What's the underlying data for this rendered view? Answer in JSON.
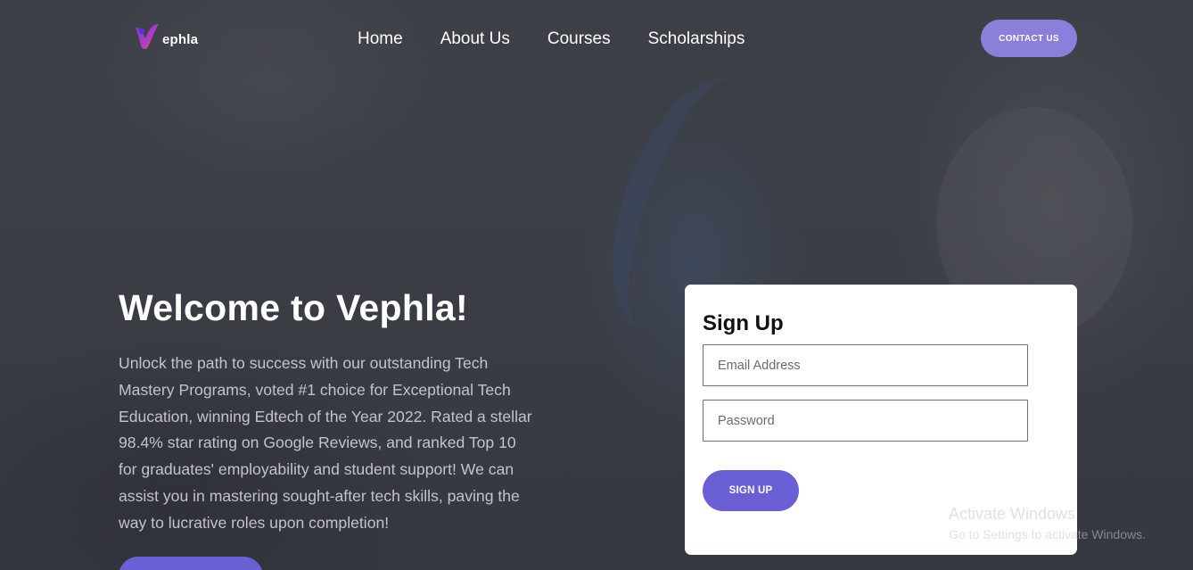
{
  "brand": {
    "logo_text": "ephla",
    "colors": {
      "accent": "#6b5fd6",
      "accent_light": "#8a80dc",
      "logo_purple": "#7a3fd0",
      "logo_orange": "#f08a2a"
    }
  },
  "nav": {
    "links": [
      "Home",
      "About Us",
      "Courses",
      "Scholarships"
    ],
    "contact_label": "CONTACT US"
  },
  "hero": {
    "title": "Welcome to Vephla!",
    "description": "Unlock the path to success with our outstanding Tech Mastery Programs, voted #1 choice for Exceptional Tech Education, winning Edtech of the Year 2022. Rated a stellar 98.4% star rating on Google Reviews, and ranked Top 10 for graduates' employability and student support! We can assist you in mastering sought-after tech skills, paving the way to lucrative roles upon completion!"
  },
  "signup": {
    "title": "Sign Up",
    "email_placeholder": "Email Address",
    "password_placeholder": "Password",
    "button_label": "SIGN UP"
  },
  "watermark": {
    "title": "Activate Windows",
    "subtitle": "Go to Settings to activate Windows."
  }
}
